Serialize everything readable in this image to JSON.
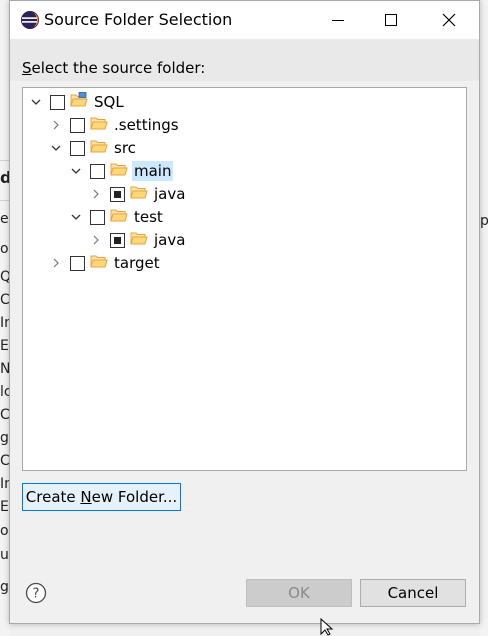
{
  "background_window": {
    "left_fragments": [
      "d",
      "e",
      "ol",
      "QL",
      "C",
      "In",
      "E",
      "N",
      "lc",
      "C",
      "gL",
      "C",
      "In",
      "E",
      "o",
      "u",
      "g"
    ],
    "right_fragment": "pe"
  },
  "dialog": {
    "title": "Source Folder Selection",
    "prompt_mnemonic": "S",
    "prompt_rest": "elect the source folder:",
    "tree": [
      {
        "label": "SQL",
        "depth": 0,
        "expanded": true,
        "checkbox": "unchecked",
        "icon": "project-icon"
      },
      {
        "label": ".settings",
        "depth": 1,
        "expanded": false,
        "checkbox": "unchecked",
        "icon": "folder-icon"
      },
      {
        "label": "src",
        "depth": 1,
        "expanded": true,
        "checkbox": "unchecked",
        "icon": "folder-icon"
      },
      {
        "label": "main",
        "depth": 2,
        "expanded": true,
        "checkbox": "unchecked",
        "icon": "folder-icon",
        "selected": true
      },
      {
        "label": "java",
        "depth": 3,
        "expanded": false,
        "checkbox": "partial",
        "icon": "folder-icon"
      },
      {
        "label": "test",
        "depth": 2,
        "expanded": true,
        "checkbox": "unchecked",
        "icon": "folder-icon"
      },
      {
        "label": "java",
        "depth": 3,
        "expanded": false,
        "checkbox": "partial",
        "icon": "folder-icon"
      },
      {
        "label": "target",
        "depth": 1,
        "expanded": false,
        "checkbox": "unchecked",
        "icon": "folder-icon"
      }
    ],
    "create_button_pre": "Create ",
    "create_button_mnemonic": "N",
    "create_button_post": "ew Folder...",
    "ok_label": "OK",
    "cancel_label": "Cancel",
    "ok_enabled": false
  },
  "colors": {
    "selection": "#cce8ff",
    "focus_border": "#0078d7",
    "folder": "#e8a33d"
  }
}
